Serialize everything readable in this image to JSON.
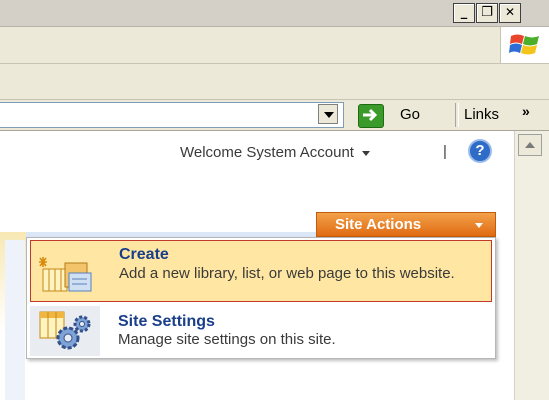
{
  "window": {
    "minimize": "_",
    "restore": "❐",
    "close": "✕"
  },
  "address_bar": {
    "value": "",
    "go_label": "Go",
    "links_label": "Links",
    "more": "»"
  },
  "header": {
    "welcome": "Welcome System Account",
    "separator": "|",
    "help": "?"
  },
  "site_actions": {
    "label": "Site Actions",
    "items": [
      {
        "title": "Create",
        "description": "Add a new library, list, or web page to this website."
      },
      {
        "title": "Site Settings",
        "description": "Manage site settings on this site."
      }
    ]
  },
  "colors": {
    "site_actions_bg": "#e57a20",
    "highlight_bg": "#ffe7a3",
    "highlight_border": "#c0392b",
    "title_color": "#1a3f8a"
  }
}
